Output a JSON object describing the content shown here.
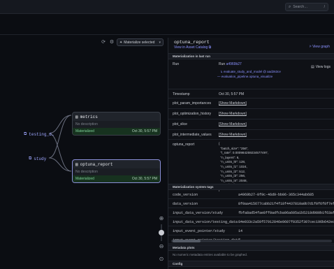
{
  "search": {
    "placeholder": "Search…",
    "shortcut": "/"
  },
  "graph": {
    "materialize_label": "Materialize selected",
    "nodes": [
      {
        "name": "metrics",
        "description": "No description",
        "status": "Materialized",
        "date": "Oct 30, 5:57 PM"
      },
      {
        "name": "optuna_report",
        "description": "No description",
        "status": "Materialized",
        "date": "Oct 30, 5:57 PM"
      }
    ],
    "upstream": [
      {
        "label": "testing_d…"
      },
      {
        "label": "study"
      }
    ]
  },
  "panel": {
    "title": "optuna_report",
    "view_catalog": "View in Asset Catalog ⧉",
    "view_graph": "View graph",
    "sections": {
      "last_run": "Materialization in last run",
      "system_tags": "Materialization system tags",
      "plots": "Metadata plots",
      "config": "Config"
    },
    "run": {
      "label": "Run",
      "run_prefix": "Run ",
      "run_id": "a4969b27",
      "job_line": "evaluate_study_and_model @ aad263ce",
      "pipeline_line": "evaluation_pipeline.optuna_visualize",
      "view_logs": "View logs"
    },
    "timestamp": {
      "label": "Timestamp",
      "value": "Oct 30, 5:57 PM"
    },
    "plots": [
      {
        "label": "plot_param_importances",
        "value": "[Show Markdown]"
      },
      {
        "label": "plot_optimization_history",
        "value": "[Show Markdown]"
      },
      {
        "label": "plot_slice",
        "value": "[Show Markdown]"
      },
      {
        "label": "plot_intermediate_values",
        "value": "[Show Markdown]"
      }
    ],
    "optuna_report": {
      "label": "optuna_report",
      "value": "{\n  \"batch_size\": \"256\",\n  \"l_rate\": 0.000984259234577497,\n  \"n_layers\": 6,\n  \"n_units_l0\": 128,\n  \"n_units_l1\": 1024,\n  \"n_units_l2\": 512,\n  \"n_units_l3\": 256,\n  \"n_units_l4\": 2048,\n  \"n_units_l5\": 1024\n}"
    },
    "tags": [
      {
        "key": "code_version",
        "value": "a4969b27-0f9c-46d9-bb06-365c344ab685"
      },
      {
        "key": "data_version",
        "value": "8f0aa415677cabb21f4f18f4437810a0b7d1f0f6f8f7ef0d0983f4"
      },
      {
        "key": "input_data_version/study",
        "value": "fbfa8ad54fae8ff0adfcba96a605a1b5218d980b1f63af338623ba"
      },
      {
        "key": "input_data_version/testing_data",
        "value": "84e033c2a59f57912846e9607f0352f307cec196b642ecc73c3f"
      },
      {
        "key": "input_event_pointer/study",
        "value": "14"
      },
      {
        "key": "input_event_pointer/testing_data",
        "value": "7"
      }
    ],
    "plots_empty": "No numeric metadata entries available to be graphed."
  }
}
